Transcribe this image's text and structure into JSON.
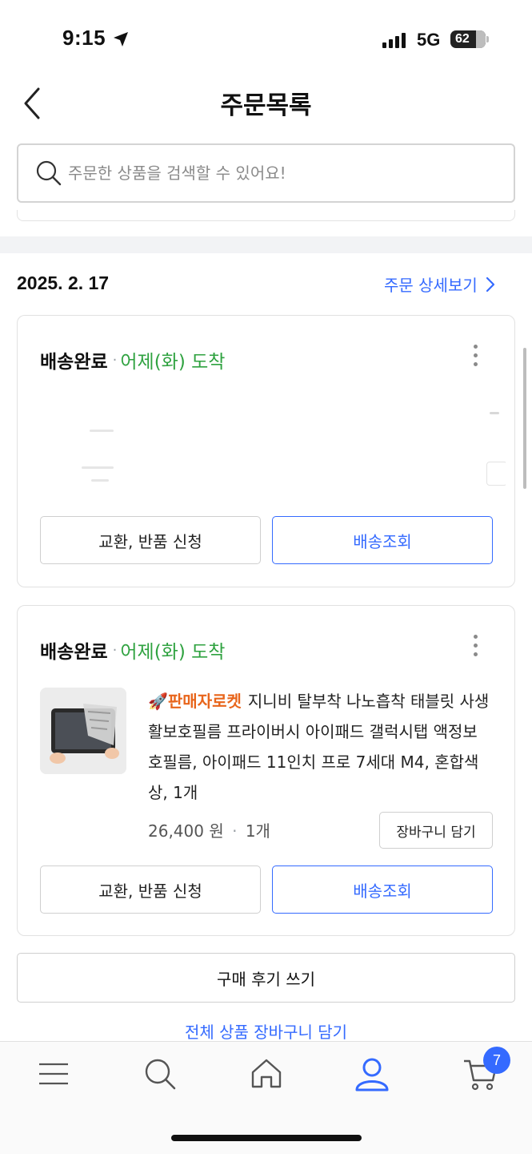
{
  "status_bar": {
    "time": "9:15",
    "network": "5G",
    "battery": "62"
  },
  "header": {
    "title": "주문목록"
  },
  "search": {
    "placeholder": "주문한 상품을 검색할 수 있어요!"
  },
  "order": {
    "date": "2025. 2. 17",
    "detail_link": "주문 상세보기"
  },
  "cards": [
    {
      "status": "배송완료",
      "arrival": "어제(화) 도착",
      "exchange_button": "교환, 반품 신청",
      "tracking_button": "배송조회"
    },
    {
      "status": "배송완료",
      "arrival": "어제(화) 도착",
      "badge": "판매자로켓",
      "product_name": "지니비 탈부착 나노흡착 태블릿 사생활보호필름 프라이버시 아이패드 갤럭시탭 액정보호필름, 아이패드 11인치 프로 7세대 M4, 혼합색상, 1개",
      "price": "26,400 원",
      "quantity": "1개",
      "cart_button": "장바구니 담기",
      "exchange_button": "교환, 반품 신청",
      "tracking_button": "배송조회"
    }
  ],
  "review_button": "구매 후기 쓰기",
  "all_cart_link": "전체 상품 장바구니 담기",
  "bottom_nav": {
    "cart_count": "7",
    "items": [
      "menu-icon",
      "search-icon",
      "home-icon",
      "my-account-icon",
      "cart-icon"
    ],
    "active_color": "#346aff"
  },
  "colors": {
    "accent": "#346aff",
    "arrival_green": "#2fa240",
    "rocket_orange": "#e8651b"
  }
}
